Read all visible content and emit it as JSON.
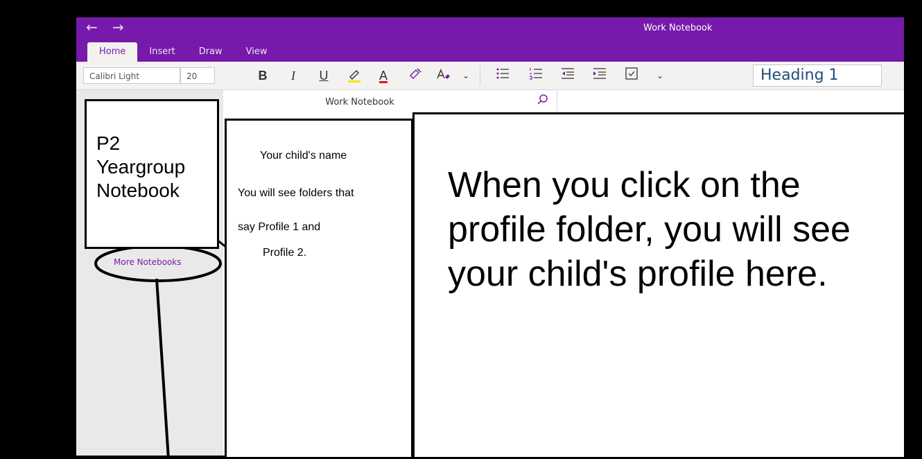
{
  "titlebar": {
    "window_title": "Work Notebook",
    "back_glyph": "←",
    "forward_glyph": "→",
    "accent_color": "#7719aa"
  },
  "tabs": [
    {
      "label": "Home",
      "active": true
    },
    {
      "label": "Insert",
      "active": false
    },
    {
      "label": "Draw",
      "active": false
    },
    {
      "label": "View",
      "active": false
    }
  ],
  "ribbon": {
    "font_name": "Calibri Light",
    "font_size": "20",
    "bold": "B",
    "italic": "I",
    "underline": "U",
    "font_color_glyph": "A",
    "style": "Heading 1",
    "highlight_color": "#f2e600",
    "font_color": "#e81123"
  },
  "notebook_header": "Work Notebook",
  "sidebar": {
    "more_notebooks": "More Notebooks"
  },
  "callouts": {
    "left": [
      "P2",
      "Yeargroup",
      "Notebook"
    ],
    "middle": {
      "line1": "Your child's name",
      "line2": "You will see folders that",
      "line3": "say Profile 1 and",
      "line4": "Profile 2."
    },
    "right": "When you click on the profile folder, you will see your child's profile here."
  }
}
